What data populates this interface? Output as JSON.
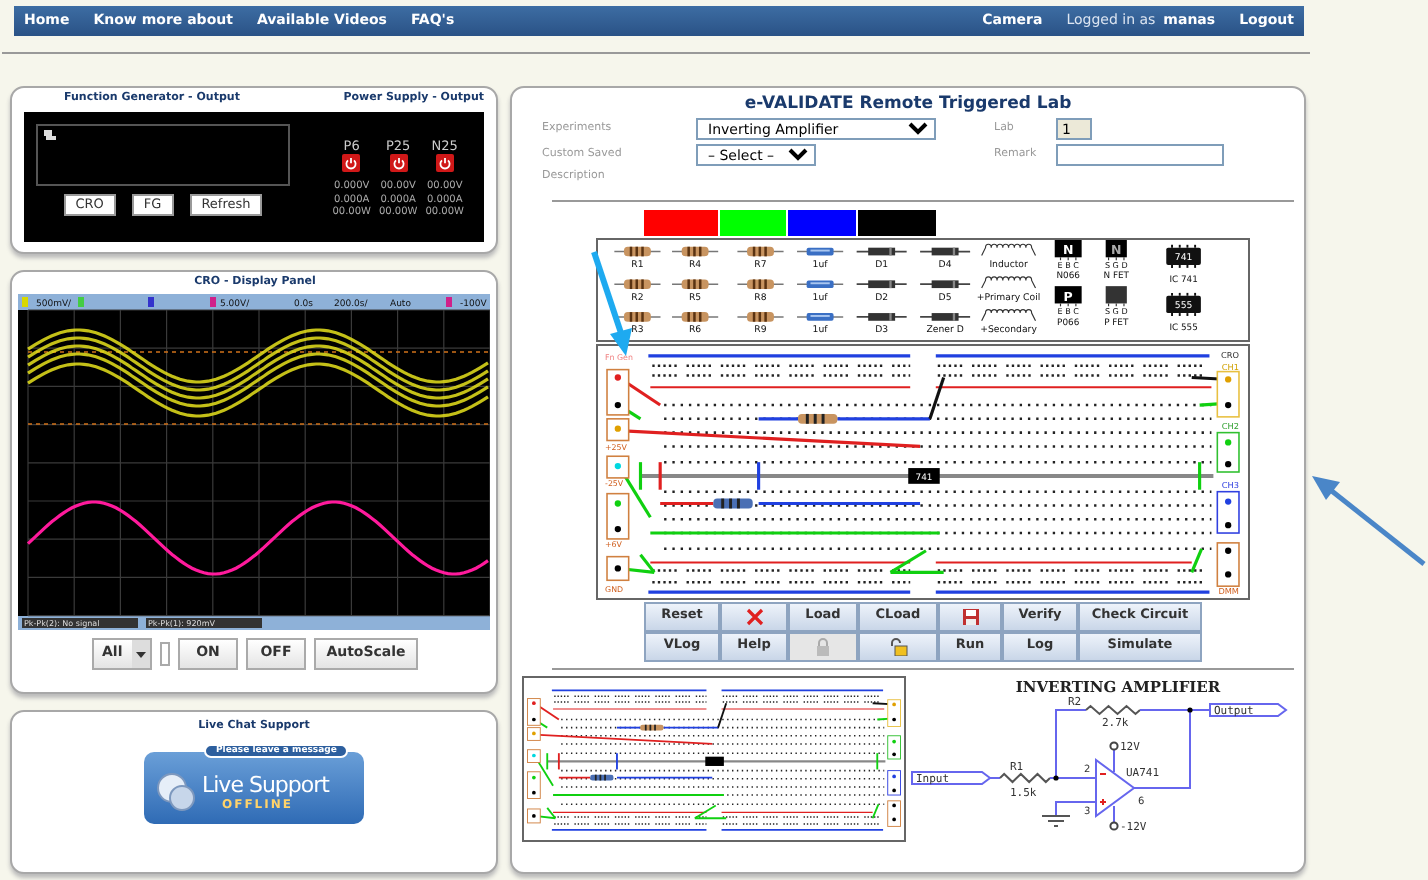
{
  "nav": {
    "links": [
      {
        "label": "Home"
      },
      {
        "label": "Know more about"
      },
      {
        "label": "Available Videos"
      },
      {
        "label": "FAQ's"
      }
    ],
    "camera": "Camera",
    "login_prefix": "Logged in as",
    "user": "manas",
    "logout": "Logout"
  },
  "function_generator": {
    "title": "Function Generator - Output",
    "buttons": [
      "CRO",
      "FG",
      "Refresh"
    ]
  },
  "power_supply": {
    "title": "Power Supply - Output",
    "channels": [
      {
        "name": "P6",
        "voltage": "0.000V",
        "current": "0.000A",
        "power": "00.00W"
      },
      {
        "name": "P25",
        "voltage": "00.00V",
        "current": "0.000A",
        "power": "00.00W"
      },
      {
        "name": "N25",
        "voltage": "00.00V",
        "current": "0.000A",
        "power": "00.00W"
      }
    ]
  },
  "cro": {
    "title": "CRO - Display Panel",
    "header": [
      "500mV/",
      "5.00V/",
      "0.0s",
      "200.0s/",
      "Auto",
      "-100V"
    ],
    "footer": [
      "Pk-Pk(2): No signal",
      "Pk-Pk(1): 920mV"
    ],
    "channel_select": "All",
    "buttons": [
      "ON",
      "OFF",
      "AutoScale"
    ]
  },
  "live_chat": {
    "title": "Live Chat Support",
    "badge_caption": "Please leave a message",
    "badge_title": "Live Support",
    "badge_status": "OFFLINE"
  },
  "lab": {
    "title": "e-VALIDATE Remote Triggered Lab",
    "experiments": {
      "label": "Experiments",
      "value": "Inverting Amplifier"
    },
    "custom": {
      "label": "Custom Saved",
      "label_2": "Description",
      "value": "– Select –"
    },
    "lab_no": {
      "label": "Lab",
      "value": "1"
    },
    "remark": {
      "label": "Remark"
    },
    "wire_colors": [
      {
        "color": "#ff0000"
      },
      {
        "color": "#00ff00"
      },
      {
        "color": "#0000ff"
      },
      {
        "color": "#000000"
      }
    ],
    "parts": [
      {
        "kind": "resistor",
        "label": "R1"
      },
      {
        "kind": "resistor",
        "label": "R4"
      },
      {
        "kind": "resistor",
        "label": "R7"
      },
      {
        "kind": "capacitor",
        "label": "1uf"
      },
      {
        "kind": "diode",
        "label": "D1"
      },
      {
        "kind": "diode",
        "label": "D4"
      },
      {
        "kind": "coil",
        "label": "Inductor"
      },
      {
        "kind": "resistor",
        "label": "R2"
      },
      {
        "kind": "resistor",
        "label": "R5"
      },
      {
        "kind": "resistor",
        "label": "R8"
      },
      {
        "kind": "capacitor",
        "label": "1uf"
      },
      {
        "kind": "diode",
        "label": "D2"
      },
      {
        "kind": "diode",
        "label": "D5"
      },
      {
        "kind": "coil",
        "label": "+Primary Coil"
      },
      {
        "kind": "resistor",
        "label": "R3"
      },
      {
        "kind": "resistor",
        "label": "R6"
      },
      {
        "kind": "resistor",
        "label": "R9"
      },
      {
        "kind": "capacitor",
        "label": "1uf"
      },
      {
        "kind": "diode",
        "label": "D3"
      },
      {
        "kind": "diode",
        "label": "Zener D"
      },
      {
        "kind": "coil",
        "label": "+Secondary"
      }
    ],
    "devices": [
      {
        "kind": "bjt",
        "chip": "N",
        "pins": "E B C",
        "label": "N066"
      },
      {
        "kind": "fet",
        "chip": "N",
        "pins": "S G D",
        "label": "N FET"
      },
      {
        "kind": "ic",
        "chip": "741",
        "label": "IC 741"
      },
      {
        "kind": "bjt",
        "chip": "P",
        "pins": "E B C",
        "label": "P066"
      },
      {
        "kind": "fet",
        "pins": "S G D",
        "label": "P FET"
      },
      {
        "kind": "ic",
        "chip": "555",
        "label": "IC 555"
      }
    ],
    "breadboard": {
      "left_labels": [
        "Fn Gen",
        "+25V",
        "-25V",
        "+6V",
        "GND"
      ],
      "right_labels": [
        "CRO",
        "CH1",
        "CH2",
        "CH3",
        "DMM"
      ],
      "chip": "741"
    },
    "toolbar": [
      {
        "kind": "text",
        "label": "Reset",
        "disabled": false
      },
      {
        "kind": "delete",
        "disabled": false
      },
      {
        "kind": "text",
        "label": "Load",
        "disabled": false
      },
      {
        "kind": "text",
        "label": "CLoad",
        "disabled": false
      },
      {
        "kind": "save",
        "disabled": false
      },
      {
        "kind": "text",
        "label": "Verify",
        "disabled": false
      },
      {
        "kind": "text",
        "label": "Check Circuit",
        "disabled": false
      },
      {
        "kind": "text",
        "label": "VLog",
        "disabled": false
      },
      {
        "kind": "text",
        "label": "Help",
        "disabled": false
      },
      {
        "kind": "lock",
        "disabled": true
      },
      {
        "kind": "unlock",
        "disabled": false
      },
      {
        "kind": "text",
        "label": "Run",
        "disabled": false
      },
      {
        "kind": "text",
        "label": "Log",
        "disabled": false
      },
      {
        "kind": "text",
        "label": "Simulate",
        "disabled": false
      }
    ],
    "schematic": {
      "title": "INVERTING AMPLIFIER",
      "r2": "R2",
      "r2_value": "2.7k",
      "output": "Output",
      "vpos": "12V",
      "opamp": "UA741",
      "input": "Input",
      "r1": "R1",
      "r1_value": "1.5k",
      "vneg": "-12V",
      "pins": [
        "2",
        "3",
        "6"
      ]
    }
  }
}
